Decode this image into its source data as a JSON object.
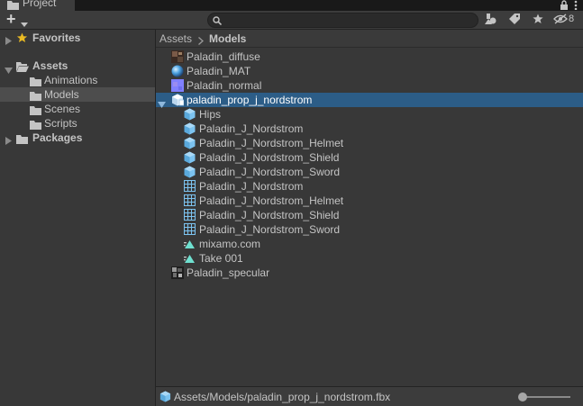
{
  "window": {
    "tab_label": "Project",
    "hidden_count": "8"
  },
  "toolbar": {
    "add_label": "+",
    "search_placeholder": ""
  },
  "sidebar": {
    "favorites": "Favorites",
    "assets": "Assets",
    "animations": "Animations",
    "models": "Models",
    "scenes": "Scenes",
    "scripts": "Scripts",
    "packages": "Packages"
  },
  "breadcrumb": {
    "root": "Assets",
    "current": "Models"
  },
  "files": [
    {
      "label": "Paladin_diffuse",
      "icon": "texture-diffuse-icon"
    },
    {
      "label": "Paladin_MAT",
      "icon": "material-icon"
    },
    {
      "label": "Paladin_normal",
      "icon": "texture-normal-icon"
    },
    {
      "label": "paladin_prop_j_nordstrom",
      "icon": "model-prefab-icon"
    },
    {
      "label": "Hips",
      "icon": "game-object-icon"
    },
    {
      "label": "Paladin_J_Nordstrom",
      "icon": "game-object-icon"
    },
    {
      "label": "Paladin_J_Nordstrom_Helmet",
      "icon": "game-object-icon"
    },
    {
      "label": "Paladin_J_Nordstrom_Shield",
      "icon": "game-object-icon"
    },
    {
      "label": "Paladin_J_Nordstrom_Sword",
      "icon": "game-object-icon"
    },
    {
      "label": "Paladin_J_Nordstrom",
      "icon": "mesh-icon"
    },
    {
      "label": "Paladin_J_Nordstrom_Helmet",
      "icon": "mesh-icon"
    },
    {
      "label": "Paladin_J_Nordstrom_Shield",
      "icon": "mesh-icon"
    },
    {
      "label": "Paladin_J_Nordstrom_Sword",
      "icon": "mesh-icon"
    },
    {
      "label": "mixamo.com",
      "icon": "animation-clip-icon"
    },
    {
      "label": "Take 001",
      "icon": "animation-clip-icon"
    },
    {
      "label": "Paladin_specular",
      "icon": "texture-specular-icon"
    }
  ],
  "status": {
    "path": "Assets/Models/paladin_prop_j_nordstrom.fbx"
  },
  "colors": {
    "selection_blue": "#2c5d87",
    "selection_gray": "#4d4d4d",
    "star_gold": "#e8b923",
    "cube_blue": "#7cc3f0",
    "anim_teal": "#6fe0d0"
  }
}
